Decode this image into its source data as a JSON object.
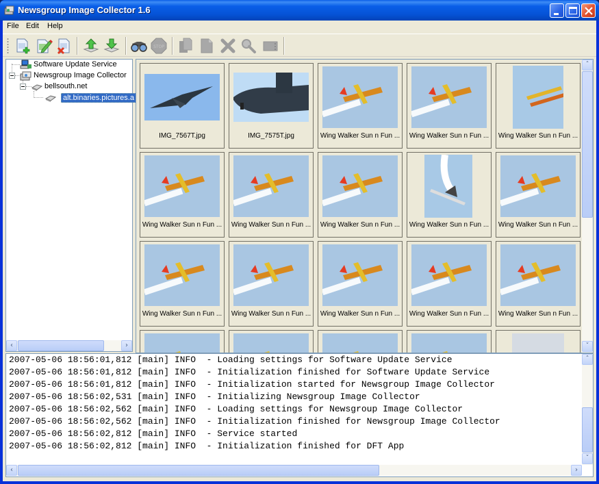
{
  "window": {
    "title": "Newsgroup Image Collector 1.6",
    "controls": [
      "minimize",
      "maximize",
      "close"
    ]
  },
  "menu": [
    "File",
    "Edit",
    "Help"
  ],
  "toolbar": {
    "buttons": [
      {
        "name": "new-icon",
        "label": "New",
        "enabled": true
      },
      {
        "name": "edit-icon",
        "label": "Edit",
        "enabled": true
      },
      {
        "name": "delete-icon",
        "label": "Delete",
        "enabled": true
      },
      {
        "name": "upload-icon",
        "label": "Upload",
        "enabled": true
      },
      {
        "name": "download-icon",
        "label": "Download",
        "enabled": true
      },
      {
        "name": "binoculars-icon",
        "label": "Find",
        "enabled": true
      },
      {
        "name": "stop-icon",
        "label": "Stop",
        "enabled": false
      },
      {
        "name": "copy-icon",
        "label": "Copy",
        "enabled": false
      },
      {
        "name": "paste-icon",
        "label": "Paste",
        "enabled": false
      },
      {
        "name": "remove-icon",
        "label": "Remove",
        "enabled": false
      },
      {
        "name": "zoom-icon",
        "label": "View",
        "enabled": false
      },
      {
        "name": "window-icon",
        "label": "Window",
        "enabled": false
      }
    ]
  },
  "tree": {
    "items": [
      {
        "label": "Software Update Service",
        "level": 0,
        "expanded": null,
        "selected": false
      },
      {
        "label": "Newsgroup Image Collector",
        "level": 0,
        "expanded": true,
        "selected": false
      },
      {
        "label": "bellsouth.net",
        "level": 1,
        "expanded": true,
        "selected": false
      },
      {
        "label": "alt.binaries.pictures.a",
        "level": 2,
        "expanded": null,
        "selected": true
      }
    ]
  },
  "thumbnails": [
    {
      "caption": "IMG_7567T.jpg",
      "kind": "jet"
    },
    {
      "caption": "IMG_7575T.jpg",
      "kind": "jet-close"
    },
    {
      "caption": "Wing Walker Sun n Fun ...",
      "kind": "biplane"
    },
    {
      "caption": "Wing Walker Sun n Fun ...",
      "kind": "biplane"
    },
    {
      "caption": "Wing Walker Sun n Fun ...",
      "kind": "biplane-small"
    },
    {
      "caption": "Wing Walker Sun n Fun ...",
      "kind": "biplane"
    },
    {
      "caption": "Wing Walker Sun n Fun ...",
      "kind": "biplane"
    },
    {
      "caption": "Wing Walker Sun n Fun ...",
      "kind": "biplane"
    },
    {
      "caption": "Wing Walker Sun n Fun ...",
      "kind": "biplane-smoke"
    },
    {
      "caption": "Wing Walker Sun n Fun ...",
      "kind": "biplane"
    },
    {
      "caption": "Wing Walker Sun n Fun ...",
      "kind": "biplane"
    },
    {
      "caption": "Wing Walker Sun n Fun ...",
      "kind": "biplane"
    },
    {
      "caption": "Wing Walker Sun n Fun ...",
      "kind": "biplane"
    },
    {
      "caption": "Wing Walker Sun n Fun ...",
      "kind": "biplane"
    },
    {
      "caption": "Wing Walker Sun n Fun ...",
      "kind": "biplane"
    },
    {
      "caption": "",
      "kind": "biplane"
    },
    {
      "caption": "",
      "kind": "biplane"
    },
    {
      "caption": "",
      "kind": "biplane"
    },
    {
      "caption": "",
      "kind": "biplane"
    },
    {
      "caption": "",
      "kind": "blank"
    }
  ],
  "log": {
    "lines": [
      "2007-05-06 18:56:01,812 [main] INFO  - Loading settings for Software Update Service",
      "2007-05-06 18:56:01,812 [main] INFO  - Initialization finished for Software Update Service",
      "2007-05-06 18:56:01,812 [main] INFO  - Initialization started for Newsgroup Image Collector",
      "2007-05-06 18:56:02,531 [main] INFO  - Initializing Newsgroup Image Collector",
      "2007-05-06 18:56:02,562 [main] INFO  - Loading settings for Newsgroup Image Collector",
      "2007-05-06 18:56:02,562 [main] INFO  - Initialization finished for Newsgroup Image Collector",
      "2007-05-06 18:56:02,812 [main] INFO  - Service started",
      "2007-05-06 18:56:02,812 [main] INFO  - Initialization finished for DFT App"
    ]
  },
  "colors": {
    "titlebar": "#0553d6",
    "selection": "#316ac5",
    "panel": "#ece9d8",
    "border": "#7f9db9"
  }
}
